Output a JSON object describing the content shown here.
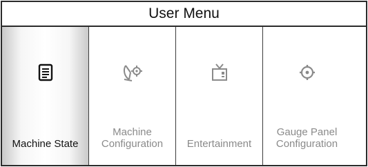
{
  "window": {
    "title": "User Menu"
  },
  "tiles": [
    {
      "label": "Machine State",
      "icon": "document-icon",
      "selected": true
    },
    {
      "label": "Machine\nConfiguration",
      "icon": "satellite-dish-icon",
      "selected": false
    },
    {
      "label": "Entertainment",
      "icon": "tv-icon",
      "selected": false
    },
    {
      "label": "Gauge Panel\nConfiguration",
      "icon": "gear-icon",
      "selected": false
    }
  ],
  "colors": {
    "border": "#2a2a2a",
    "selected_text": "#111111",
    "unselected_text": "#8a8a8a"
  }
}
